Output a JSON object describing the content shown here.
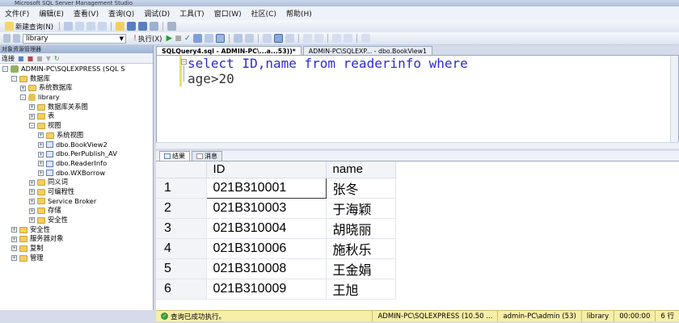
{
  "window": {
    "title": "Microsoft SQL Server Management Studio"
  },
  "menu": [
    "文件(F)",
    "编辑(E)",
    "查看(V)",
    "查询(Q)",
    "调试(D)",
    "工具(T)",
    "窗口(W)",
    "社区(C)",
    "帮助(H)"
  ],
  "toolbar": {
    "new_query_label": "新建查询(N)",
    "database_select": "library",
    "execute_label": "执行(X)"
  },
  "object_explorer": {
    "title": "对象资源管理器",
    "connect_label": "连接",
    "tree": [
      {
        "label": "ADMIN-PC\\SQLEXPRESS (SQL S",
        "expander": "-",
        "icon": "server-icon"
      },
      {
        "label": "数据库",
        "expander": "-",
        "icon": "folder-icon"
      },
      {
        "label": "系统数据库",
        "expander": "+",
        "icon": "folder-icon"
      },
      {
        "label": "library",
        "expander": "-",
        "icon": "database-icon"
      },
      {
        "label": "数据库关系图",
        "expander": "+",
        "icon": "folder-icon"
      },
      {
        "label": "表",
        "expander": "+",
        "icon": "folder-icon"
      },
      {
        "label": "视图",
        "expander": "-",
        "icon": "folder-icon"
      },
      {
        "label": "系统视图",
        "expander": "+",
        "icon": "folder-icon"
      },
      {
        "label": "dbo.BookView2",
        "expander": "+",
        "icon": "view-icon"
      },
      {
        "label": "dbo.PerPublish_AV",
        "expander": "+",
        "icon": "view-icon"
      },
      {
        "label": "dbo.ReaderInfo",
        "expander": "+",
        "icon": "view-icon"
      },
      {
        "label": "dbo.WXBorrow",
        "expander": "+",
        "icon": "view-icon"
      },
      {
        "label": "同义词",
        "expander": "+",
        "icon": "folder-icon"
      },
      {
        "label": "可编程性",
        "expander": "+",
        "icon": "folder-icon"
      },
      {
        "label": "Service Broker",
        "expander": "+",
        "icon": "folder-icon"
      },
      {
        "label": "存储",
        "expander": "+",
        "icon": "folder-icon"
      },
      {
        "label": "安全性",
        "expander": "+",
        "icon": "folder-icon"
      },
      {
        "label": "安全性",
        "expander": "+",
        "icon": "folder-icon"
      },
      {
        "label": "服务器对象",
        "expander": "+",
        "icon": "folder-icon"
      },
      {
        "label": "复制",
        "expander": "+",
        "icon": "folder-icon"
      },
      {
        "label": "管理",
        "expander": "+",
        "icon": "folder-icon"
      }
    ]
  },
  "tabs": [
    {
      "label": "SQLQuery4.sql - ADMIN-PC\\...a...53))*",
      "active": true
    },
    {
      "label": "ADMIN-PC\\SQLEXP... - dbo.BookView1",
      "active": false
    }
  ],
  "editor": {
    "line1": {
      "kw1": "select",
      "cols": " ID,name ",
      "kw2": "from",
      "table": " readerinfo ",
      "kw3": "where"
    },
    "line2": "age>20"
  },
  "results": {
    "tab_results": "结果",
    "tab_messages": "消息",
    "columns": [
      "ID",
      "name"
    ],
    "rows": [
      {
        "n": "1",
        "id": "021B310001",
        "name": "张冬"
      },
      {
        "n": "2",
        "id": "021B310003",
        "name": "于海颖"
      },
      {
        "n": "3",
        "id": "021B310004",
        "name": "胡晓丽"
      },
      {
        "n": "4",
        "id": "021B310006",
        "name": "施秋乐"
      },
      {
        "n": "5",
        "id": "021B310008",
        "name": "王金娟"
      },
      {
        "n": "6",
        "id": "021B310009",
        "name": "王旭"
      }
    ]
  },
  "status": {
    "message": "查询已成功执行。",
    "server": "ADMIN-PC\\SQLEXPRESS (10.50 ...",
    "user": "admin-PC\\admin (53)",
    "database": "library",
    "elapsed": "00:00:00",
    "rows": "6 行"
  }
}
